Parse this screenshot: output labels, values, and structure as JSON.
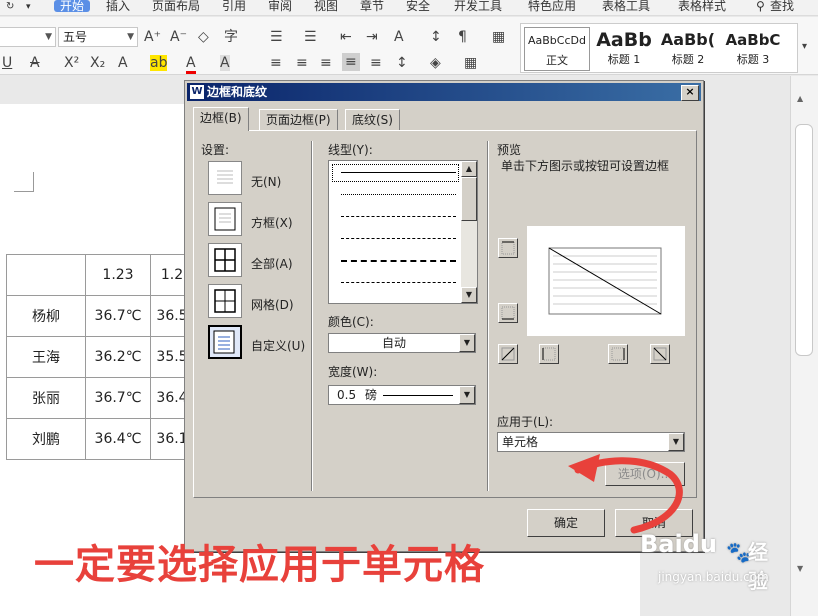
{
  "menubar": {
    "items": [
      "开始",
      "插入",
      "页面布局",
      "引用",
      "审阅",
      "视图",
      "章节",
      "安全",
      "开发工具",
      "特色应用",
      "表格工具",
      "表格样式"
    ],
    "search": "查找"
  },
  "ribbon": {
    "font_size": "五号",
    "styles": [
      {
        "preview": "AaBbCcDd",
        "name": "正文"
      },
      {
        "preview": "AaBb",
        "name": "标题 1"
      },
      {
        "preview": "AaBb(",
        "name": "标题 2"
      },
      {
        "preview": "AaBbC",
        "name": "标题 3"
      }
    ]
  },
  "table": {
    "header": [
      "",
      "1.23",
      "1.2"
    ],
    "rows": [
      [
        "杨柳",
        "36.7℃",
        "36.5"
      ],
      [
        "王海",
        "36.2℃",
        "35.5"
      ],
      [
        "张丽",
        "36.7℃",
        "36.4"
      ],
      [
        "刘鹏",
        "36.4℃",
        "36.1"
      ]
    ]
  },
  "dialog": {
    "title": "边框和底纹",
    "close": "×",
    "tabs": [
      "边框(B)",
      "页面边框(P)",
      "底纹(S)"
    ],
    "settings_label": "设置:",
    "settings": [
      "无(N)",
      "方框(X)",
      "全部(A)",
      "网格(D)",
      "自定义(U)"
    ],
    "linestyle_label": "线型(Y):",
    "color_label": "颜色(C):",
    "color_value": "自动",
    "width_label": "宽度(W):",
    "width_value": "0.5",
    "width_unit": "磅",
    "preview_label": "预览",
    "preview_hint": "单击下方图示或按钮可设置边框",
    "apply_label": "应用于(L):",
    "apply_value": "单元格",
    "options_button": "选项(O)...",
    "ok_button": "确定",
    "cancel_button": "取消"
  },
  "annotation": "一定要选择应用于单元格",
  "watermark": {
    "brand": "Baidu",
    "cn": "经验",
    "url": "jingyan.baidu.com"
  },
  "colors": {
    "annotation": "#e8413b",
    "title_bar": "#0a246a",
    "menu_active": "#5b8fe6"
  }
}
